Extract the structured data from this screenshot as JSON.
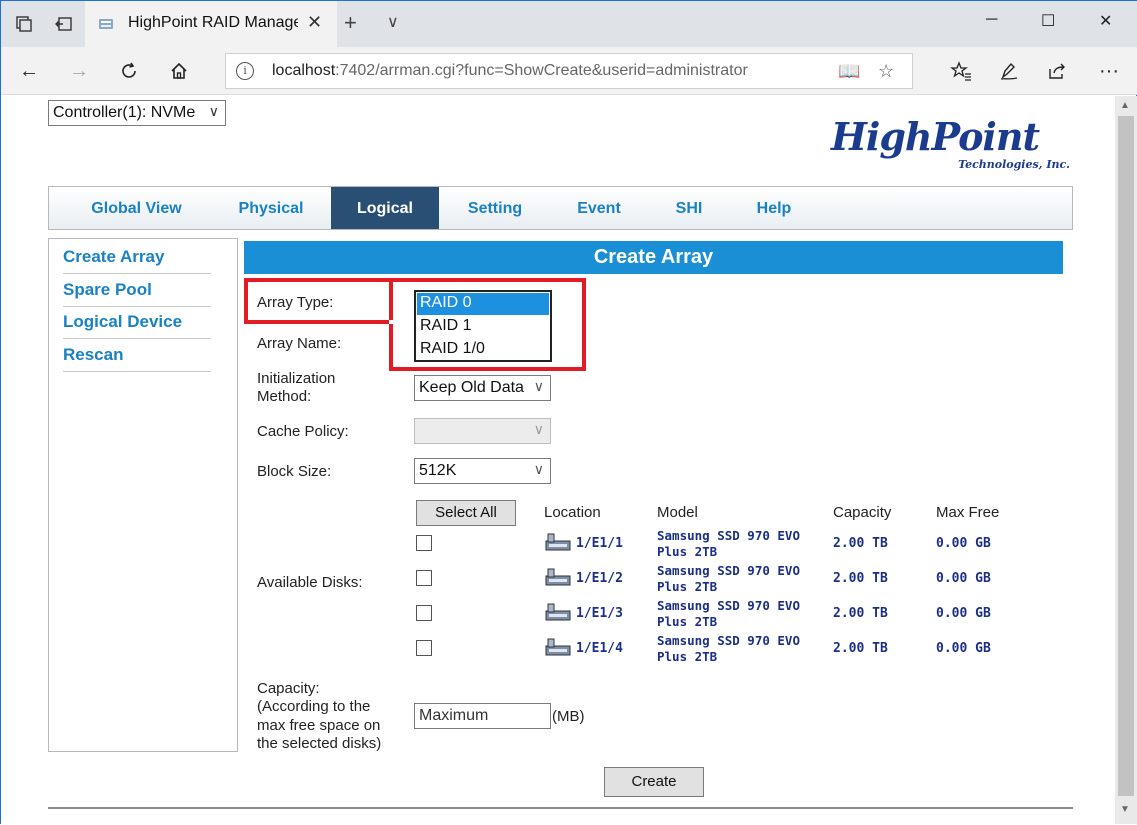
{
  "browser": {
    "tab_title": "HighPoint RAID Manage",
    "url_host": "localhost",
    "url_rest": ":7402/arrman.cgi?func=ShowCreate&userid=administrator"
  },
  "page": {
    "controller_select": "Controller(1): NVMe",
    "logo_main": "HighPoint",
    "logo_sub": "Technologies, Inc.",
    "menu": [
      "Global View",
      "Physical",
      "Logical",
      "Setting",
      "Event",
      "SHI",
      "Help"
    ],
    "active_menu": "Logical",
    "sidebar": [
      "Create Array",
      "Spare Pool",
      "Logical Device",
      "Rescan"
    ],
    "title": "Create Array",
    "form": {
      "array_type_label": "Array Type:",
      "array_type_options": [
        "RAID 0",
        "RAID 1",
        "RAID 1/0"
      ],
      "array_type_selected": "RAID 0",
      "array_name_label": "Array Name:",
      "init_label_1": "Initialization",
      "init_label_2": "Method:",
      "init_value": "Keep Old Data",
      "cache_label": "Cache Policy:",
      "cache_value": "",
      "block_label": "Block Size:",
      "block_value": "512K",
      "disks_label": "Available Disks:",
      "select_all": "Select All",
      "capacity_label": [
        "Capacity:",
        "(According to the",
        "max free space on",
        "the selected disks)"
      ],
      "capacity_value": "Maximum",
      "capacity_unit": "(MB)",
      "create_button": "Create"
    },
    "disk_headers": {
      "location": "Location",
      "model": "Model",
      "capacity": "Capacity",
      "max_free": "Max Free"
    },
    "disks": [
      {
        "location": "1/E1/1",
        "model_1": "Samsung SSD 970 EVO",
        "model_2": "Plus 2TB",
        "capacity": "2.00 TB",
        "max_free": "0.00 GB"
      },
      {
        "location": "1/E1/2",
        "model_1": "Samsung SSD 970 EVO",
        "model_2": "Plus 2TB",
        "capacity": "2.00 TB",
        "max_free": "0.00 GB"
      },
      {
        "location": "1/E1/3",
        "model_1": "Samsung SSD 970 EVO",
        "model_2": "Plus 2TB",
        "capacity": "2.00 TB",
        "max_free": "0.00 GB"
      },
      {
        "location": "1/E1/4",
        "model_1": "Samsung SSD 970 EVO",
        "model_2": "Plus 2TB",
        "capacity": "2.00 TB",
        "max_free": "0.00 GB"
      }
    ]
  },
  "colors": {
    "highlight": "#e21b24",
    "menu_link": "#1a82c4",
    "active_tab": "#2a4f74",
    "title_bar": "#1b8fd6",
    "disk_text": "#1b2f86"
  }
}
